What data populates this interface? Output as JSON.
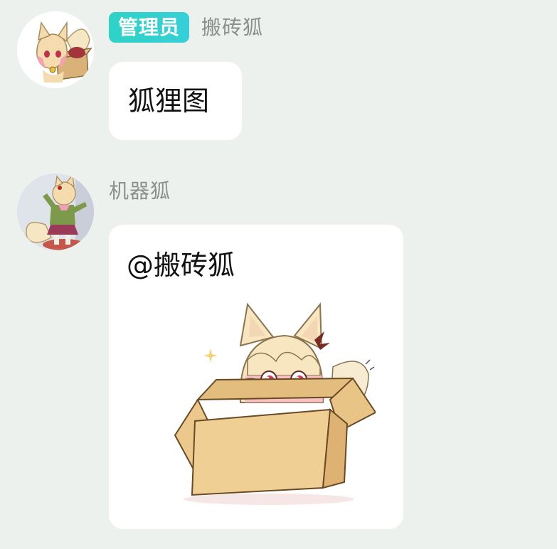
{
  "messages": [
    {
      "role_badge": "管理员",
      "sender": "搬砖狐",
      "text": "狐狸图",
      "avatar": "fox-girl-in-box-avatar"
    },
    {
      "sender": "机器狐",
      "text": "@搬砖狐",
      "avatar": "fox-girl-dancing-avatar",
      "attachment": "fox-girl-peeking-from-cardboard-box-sticker"
    }
  ],
  "colors": {
    "background": "#edf1ee",
    "bubble": "#ffffff",
    "badge": "#2ed3c6",
    "name_gray": "#8a8e8c"
  }
}
